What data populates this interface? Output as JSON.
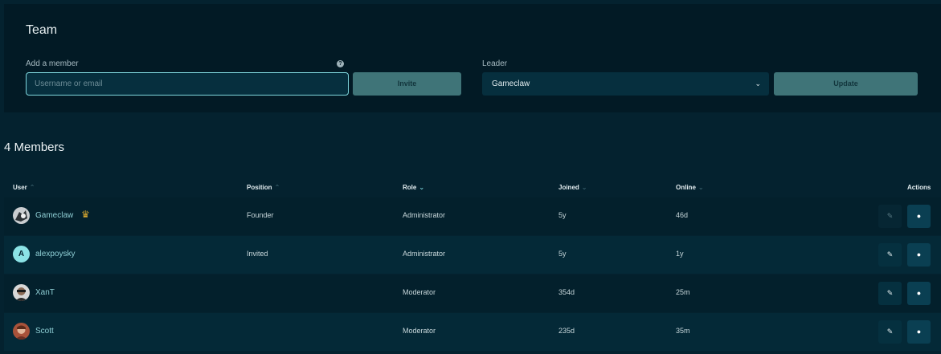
{
  "team": {
    "title": "Team",
    "add_member_label": "Add a member",
    "help_icon": "?",
    "input_placeholder": "Username or email",
    "input_value": "",
    "invite_label": "Invite",
    "leader_label": "Leader",
    "leader_value": "Gameclaw",
    "leader_chevron": "⌄",
    "update_label": "Update"
  },
  "members": {
    "title": "4 Members",
    "columns": {
      "user": "User",
      "position": "Position",
      "role": "Role",
      "joined": "Joined",
      "online": "Online",
      "actions": "Actions"
    },
    "sort_up": "⌃",
    "sort_down": "⌄",
    "crown": "♛",
    "edit_icon": "✎",
    "message_icon": "●",
    "rows": [
      {
        "name": "Gameclaw",
        "position": "Founder",
        "role": "Administrator",
        "joined": "5y",
        "online": "46d",
        "avatar_letter": ""
      },
      {
        "name": "alexpoysky",
        "position": "Invited",
        "role": "Administrator",
        "joined": "5y",
        "online": "1y",
        "avatar_letter": "A"
      },
      {
        "name": "XanT",
        "position": "",
        "role": "Moderator",
        "joined": "354d",
        "online": "25m",
        "avatar_letter": ""
      },
      {
        "name": "Scott",
        "position": "",
        "role": "Moderator",
        "joined": "235d",
        "online": "35m",
        "avatar_letter": ""
      }
    ]
  },
  "colors": {
    "background": "#04222f",
    "panel": "#021a25",
    "accent": "#7fd6dd",
    "button": "#3f7478",
    "crown": "#d9a930"
  }
}
